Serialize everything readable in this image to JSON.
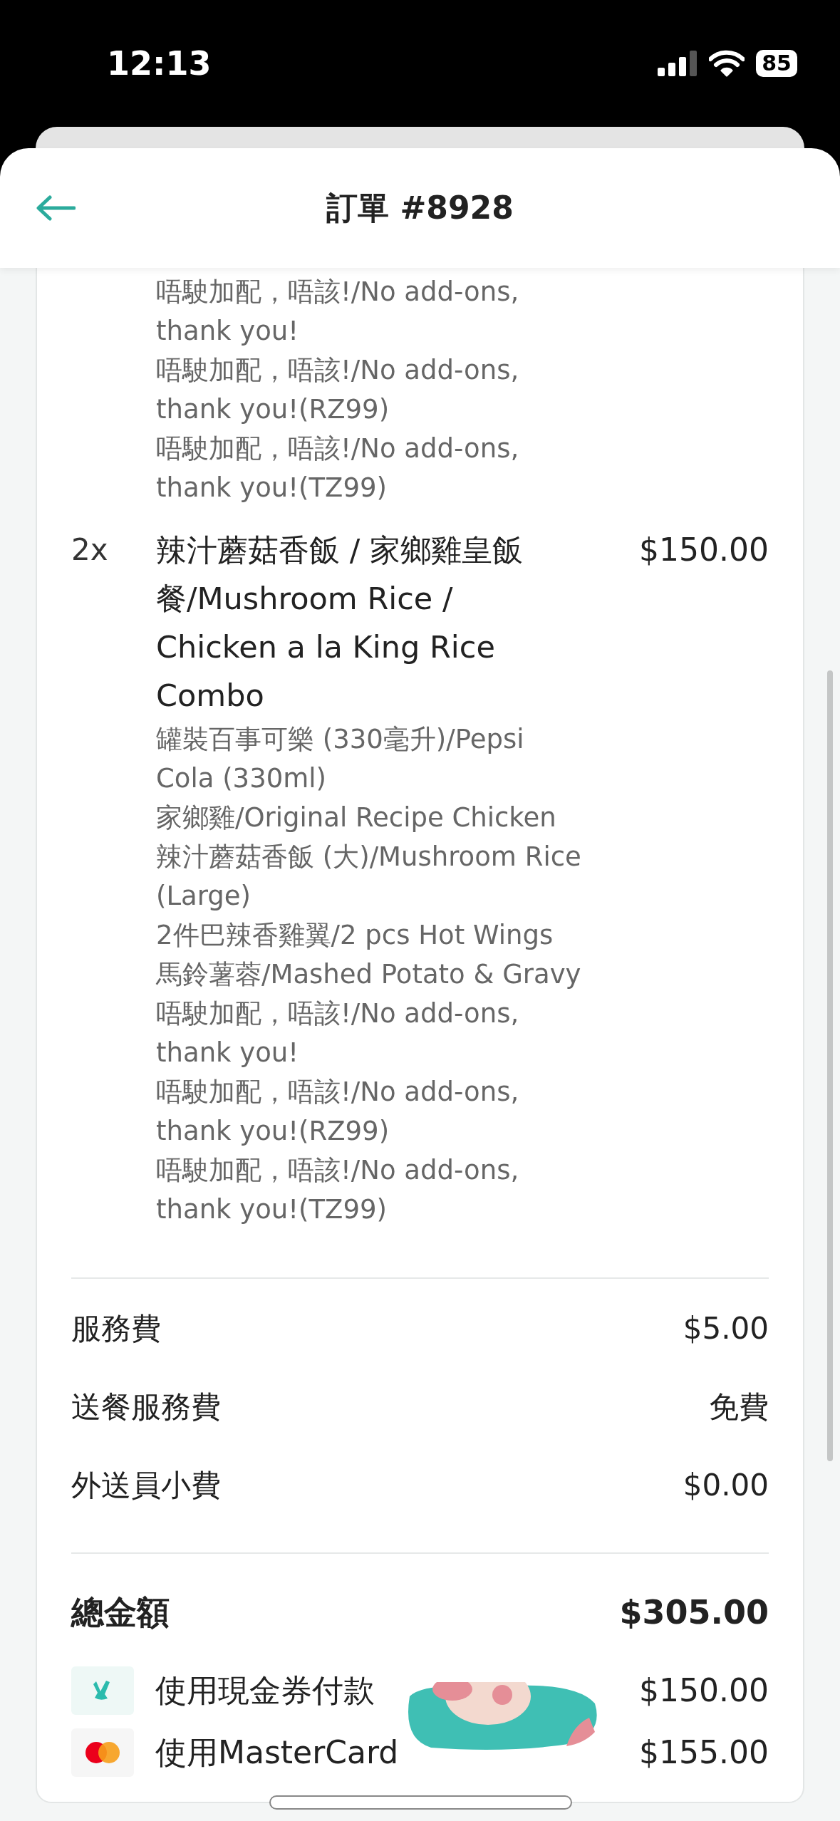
{
  "status_bar": {
    "time": "12:13",
    "battery": "85"
  },
  "header": {
    "title": "訂單 #8928"
  },
  "items": [
    {
      "options": [
        "唔駛加配，唔該!/No add-ons, thank you!",
        "唔駛加配，唔該!/No add-ons, thank you!(RZ99)",
        "唔駛加配，唔該!/No add-ons, thank you!(TZ99)"
      ]
    },
    {
      "quantity": "2x",
      "name": "辣汁蘑菇香飯 / 家鄉雞皇飯餐/Mushroom Rice / Chicken a la King Rice Combo",
      "price": "$150.00",
      "options": [
        "罐裝百事可樂 (330毫升)/Pepsi Cola (330ml)",
        "家鄉雞/Original Recipe Chicken",
        "辣汁蘑菇香飯 (大)/Mushroom Rice (Large)",
        "2件巴辣香雞翼/2 pcs Hot Wings",
        "馬鈴薯蓉/Mashed Potato & Gravy",
        "唔駛加配，唔該!/No add-ons, thank you!",
        "唔駛加配，唔該!/No add-ons, thank you!(RZ99)",
        "唔駛加配，唔該!/No add-ons, thank you!(TZ99)"
      ]
    }
  ],
  "fees": [
    {
      "label": "服務費",
      "value": "$5.00"
    },
    {
      "label": "送餐服務費",
      "value": "免費"
    },
    {
      "label": "外送員小費",
      "value": "$0.00"
    }
  ],
  "total": {
    "label": "總金額",
    "value": "$305.00"
  },
  "payments": [
    {
      "kind": "voucher",
      "label": "使用現金券付款",
      "amount": "$150.00"
    },
    {
      "kind": "mastercard",
      "label": "使用MasterCard",
      "amount": "$155.00"
    }
  ]
}
